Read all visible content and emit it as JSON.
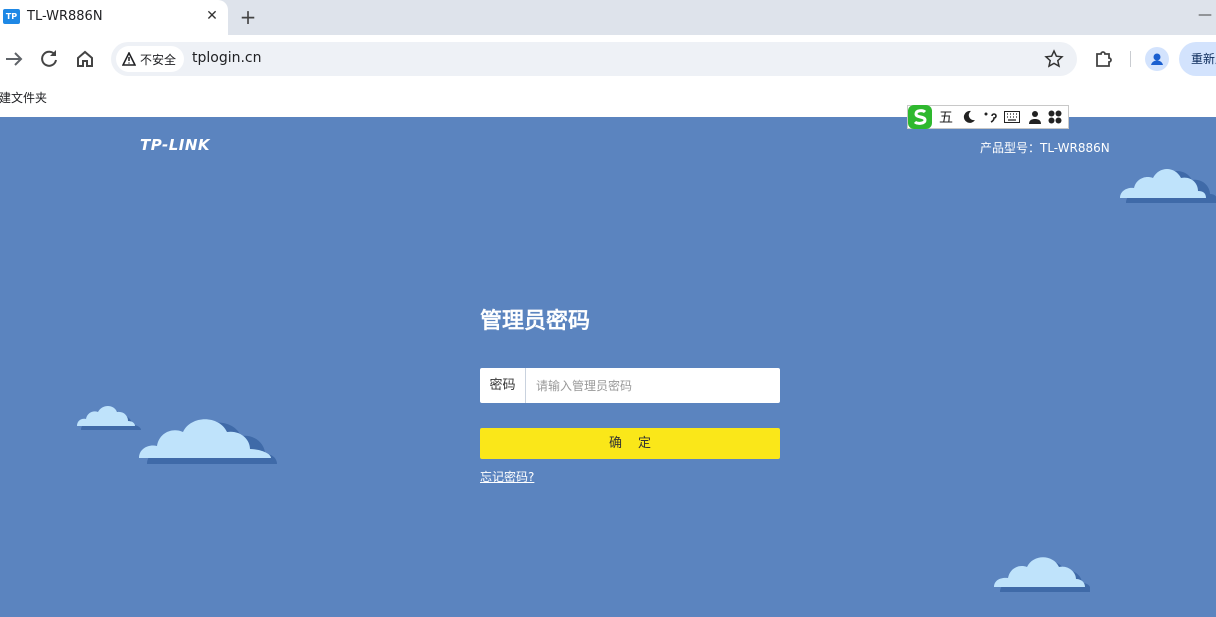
{
  "browser": {
    "tab": {
      "favicon_text": "TP",
      "title": "TL-WR886N"
    },
    "new_tab_label": "+",
    "address": {
      "security_label": "不安全",
      "url": "tplogin.cn"
    },
    "relaunch_label": "重新启动",
    "bookmarks": [
      "新建文件夹"
    ]
  },
  "ime": {
    "mode": "五",
    "items": [
      "moon-icon",
      "punctuation-icon",
      "keyboard-icon",
      "user-icon",
      "toolbox-icon"
    ]
  },
  "page": {
    "logo": "TP-LINK",
    "model": "产品型号：TL-WR886N",
    "title": "管理员密码",
    "password_label": "密码",
    "password_placeholder": "请输入管理员密码",
    "confirm_label": "确定",
    "forgot_label": "忘记密码?"
  },
  "colors": {
    "background": "#5b84bf",
    "confirm_button": "#fae719",
    "cloud_light": "#bfe3fb",
    "cloud_shadow": "#3f6aa8"
  }
}
